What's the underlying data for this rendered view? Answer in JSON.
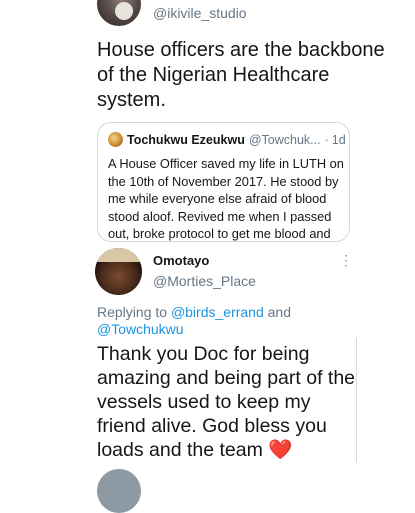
{
  "top_tweet": {
    "handle": "@ikivile_studio",
    "text": "House officers are the backbone of the Nigerian Healthcare system."
  },
  "quoted_tweet": {
    "name": "Tochukwu Ezeukwu",
    "handle": "@Towchuk...",
    "separator": "·",
    "time": "1d",
    "text": "A House Officer saved my life in LUTH on the 10th of November 2017. He stood by me while everyone else afraid of blood stood aloof. Revived me when I passed out, broke protocol to get me blood and ..."
  },
  "reply_tweet": {
    "name": "Omotayo",
    "handle": "@Morties_Place",
    "replying_prefix": "Replying to",
    "mention1": "@birds_errand",
    "connector": "and",
    "mention2": "@Towchukwu",
    "text": "Thank you Doc for being amazing and being part of the vessels used to keep my friend alive. God bless you loads and the team",
    "emoji": "❤️",
    "more_icon": "⋮"
  },
  "colors": {
    "link": "#1b95e0",
    "secondary_text": "#657786",
    "heart": "#e0245e"
  }
}
